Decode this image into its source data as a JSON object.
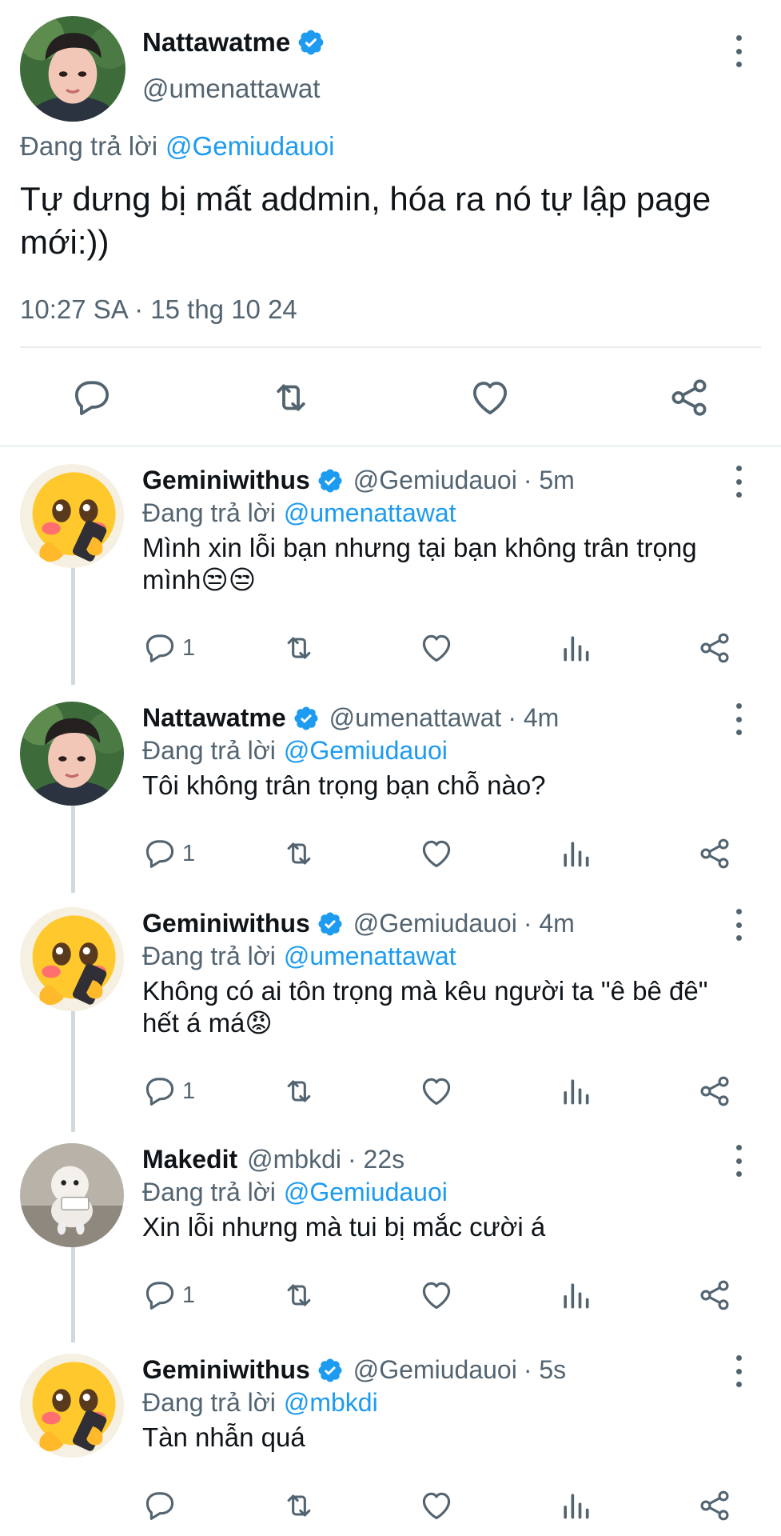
{
  "main_tweet": {
    "name": "Nattawatme",
    "handle": "@umenattawat",
    "replying_prefix": "Đang trả lời",
    "replying_to": "@Gemiudauoi",
    "text_line1": "Tự dưng bị mất addmin, hóa ra nó tự lập page",
    "text_line2": "mới:))",
    "timestamp": "10:27 SA · 15 thg 10 24",
    "avatar_icon": "user-photo-icon"
  },
  "replies": [
    {
      "name": "Geminiwithus",
      "verified": true,
      "handle": "@Gemiudauoi",
      "time": "· 5m",
      "replying_prefix": "Đang trả lời",
      "replying_to": "@umenattawat",
      "line1": "Mình xin lỗi bạn nhưng tại bạn không trân trọng",
      "line2": "mình😒😒",
      "reply_count": "1",
      "avatar_icon": "crying-emoji-avatar"
    },
    {
      "name": "Nattawatme",
      "verified": true,
      "handle": "@umenattawat",
      "time": "· 4m",
      "replying_prefix": "Đang trả lời",
      "replying_to": "@Gemiudauoi",
      "line1": "Tôi không trân trọng bạn chỗ nào?",
      "line2": "",
      "reply_count": "1",
      "avatar_icon": "user-photo-icon"
    },
    {
      "name": "Geminiwithus",
      "verified": true,
      "handle": "@Gemiudauoi",
      "time": "· 4m",
      "replying_prefix": "Đang trả lời",
      "replying_to": "@umenattawat",
      "line1": "Không có ai tôn trọng mà kêu người ta \"ê bê đê\"",
      "line2": "hết á má😡",
      "reply_count": "1",
      "avatar_icon": "crying-emoji-avatar"
    },
    {
      "name": "Makedit",
      "verified": false,
      "handle": "@mbkdi",
      "time": "· 22s",
      "replying_prefix": "Đang trả lời",
      "replying_to": "@Gemiudauoi",
      "line1": "Xin lỗi nhưng mà tui bị mắc cười á",
      "line2": "",
      "reply_count": "1",
      "avatar_icon": "puppy-photo-icon"
    },
    {
      "name": "Geminiwithus",
      "verified": true,
      "handle": "@Gemiudauoi",
      "time": "· 5s",
      "replying_prefix": "Đang trả lời",
      "replying_to": "@mbkdi",
      "line1": "Tàn nhẫn quá",
      "line2": "",
      "reply_count": "",
      "avatar_icon": "crying-emoji-avatar"
    }
  ],
  "colors": {
    "accent": "#1d9bf0",
    "secondary_text": "#536471",
    "divider": "#cfd9de"
  }
}
